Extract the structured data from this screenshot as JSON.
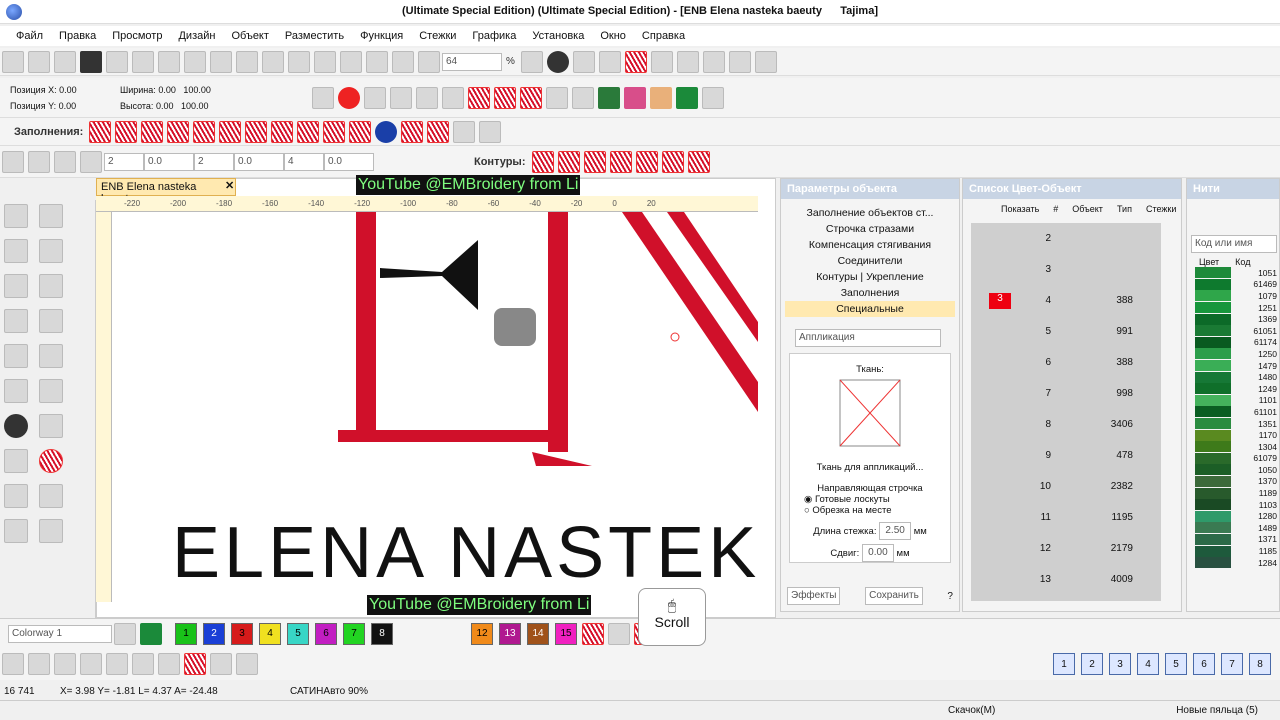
{
  "title": "(Ultimate Special Edition) (Ultimate Special Edition) - [ENB Elena nasteka baeuty",
  "title_right": "Tajima]",
  "menu": [
    "Файл",
    "Правка",
    "Просмотр",
    "Дизайн",
    "Объект",
    "Разместить",
    "Функция",
    "Стежки",
    "Графика",
    "Установка",
    "Окно",
    "Справка"
  ],
  "toolbar": {
    "zoom": "64",
    "percent": "%"
  },
  "pos": {
    "x_label": "Позиция X:",
    "x": "0.00",
    "y_label": "Позиция Y:",
    "y": "0.00",
    "w_label": "Ширина:",
    "w": "0.00",
    "w_pct": "100.00",
    "h_label": "Высота:",
    "h": "0.00",
    "h_pct": "100.00"
  },
  "fills_label": "Заполнения:",
  "contours_label": "Контуры:",
  "doc": {
    "tab": "ENB Elena nasteka baeuty",
    "close": "✕",
    "text": "ELENA NASTEK",
    "yt1": "YouTube @EMBroidery from Li",
    "yt2": "YouTube @EMBroidery from Li"
  },
  "ruler": [
    "-220",
    "-200",
    "-180",
    "-160",
    "-140",
    "-120",
    "-100",
    "-80",
    "-60",
    "-40",
    "-20",
    "0",
    "20"
  ],
  "props": {
    "header": "Параметры объекта",
    "items": [
      "Заполнение объектов ст...",
      "Строчка стразами",
      "Компенсация стягивания",
      "Соединители",
      "Контуры",
      "Укрепление",
      "Заполнения",
      "Специальные"
    ],
    "applique": "Аппликация",
    "fabric": "Ткань:",
    "fabric_btn": "Ткань для аппликаций...",
    "guide": "Направляющая строчка",
    "r1": "Готовые лоскуты",
    "r2": "Обрезка на месте",
    "len_label": "Длина стежка:",
    "len": "2.50",
    "shift_label": "Сдвиг:",
    "shift": "0.00",
    "mm": "мм",
    "effects": "Эффекты",
    "save": "Сохранить",
    "q": "?"
  },
  "colorlist": {
    "header": "Список Цвет-Объект",
    "show": "Показать",
    "cols": [
      "#",
      "Объект",
      "Тип",
      "Стежки"
    ],
    "rows": [
      {
        "n": "2",
        "s": ""
      },
      {
        "n": "3",
        "s": ""
      },
      {
        "n": "4",
        "s": "388",
        "c": "3"
      },
      {
        "n": "5",
        "s": "991"
      },
      {
        "n": "6",
        "s": "388"
      },
      {
        "n": "7",
        "s": "998"
      },
      {
        "n": "8",
        "s": "3406"
      },
      {
        "n": "9",
        "s": "478"
      },
      {
        "n": "10",
        "s": "2382"
      },
      {
        "n": "11",
        "s": "1195"
      },
      {
        "n": "12",
        "s": "2179"
      },
      {
        "n": "13",
        "s": "4009"
      }
    ]
  },
  "threads": {
    "header": "Нити",
    "search": "Код или имя",
    "col1": "Цвет",
    "col2": "Код",
    "codes": [
      "1051",
      "61469",
      "1079",
      "1251",
      "1369",
      "61051",
      "61174",
      "1250",
      "1479",
      "1480",
      "1249",
      "1101",
      "61101",
      "1351",
      "1170",
      "1304",
      "61079",
      "1050",
      "1370",
      "1189",
      "1103",
      "1280",
      "1489",
      "1371",
      "1185",
      "1284"
    ],
    "colors": [
      "#1e8a3a",
      "#0e7a2e",
      "#2fa64a",
      "#17963c",
      "#0c6a28",
      "#1a7a34",
      "#095a20",
      "#2c9e4a",
      "#3aae56",
      "#167836",
      "#0f6f2a",
      "#44b25c",
      "#0a5e22",
      "#2a8c40",
      "#5a8a20",
      "#3e7a1a",
      "#2a6a2a",
      "#1c5e26",
      "#3c6a3a",
      "#285a2c",
      "#1a4a24",
      "#2f9a6a",
      "#3a7a52",
      "#2c6a48",
      "#1e5a3c",
      "#285040"
    ]
  },
  "colorway": "Colorway 1",
  "swatches": [
    {
      "n": "1",
      "c": "#19c219"
    },
    {
      "n": "2",
      "c": "#1a3fd6"
    },
    {
      "n": "3",
      "c": "#d61a1a"
    },
    {
      "n": "4",
      "c": "#f0e020"
    },
    {
      "n": "5",
      "c": "#38d6c6"
    },
    {
      "n": "6",
      "c": "#c21ec2"
    },
    {
      "n": "7",
      "c": "#22d422"
    },
    {
      "n": "8",
      "c": "#111111"
    }
  ],
  "swatches2": [
    {
      "n": "12",
      "c": "#f08a1a"
    },
    {
      "n": "13",
      "c": "#b01890"
    },
    {
      "n": "14",
      "c": "#a0521a"
    },
    {
      "n": "15",
      "c": "#f020c0"
    }
  ],
  "scroll": "Scroll",
  "status": {
    "count": "16 741",
    "coords": "X=  3.98 Y=  -1.81 L=   4.37 A= -24.48",
    "type": "САТИНАвто 90%",
    "download": "Скачок(M)",
    "hoops": "Новые пяльца (5)"
  },
  "hoop_nums": [
    "1",
    "2",
    "3",
    "4",
    "5",
    "6",
    "7",
    "8"
  ]
}
